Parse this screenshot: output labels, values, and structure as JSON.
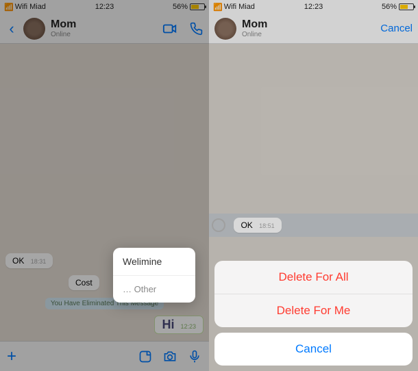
{
  "status": {
    "carrier": "Wifi Miad",
    "time": "12:23",
    "battery_pct": "56%"
  },
  "left": {
    "contact_name": "Mom",
    "contact_status": "Online",
    "messages": {
      "ok_text": "OK",
      "ok_time": "18:31",
      "cost_text": "Cost",
      "system_text": "You Have Eliminated This Message",
      "hi_text": "Hi",
      "hi_time": "12:23"
    },
    "popup": {
      "item1": "Welimine",
      "item2": "… Other"
    },
    "toolbar_plus": "+"
  },
  "right": {
    "contact_name": "Mom",
    "contact_status": "Online",
    "header_cancel": "Cancel",
    "messages": {
      "ok_text": "OK",
      "ok_time": "18:51"
    },
    "sheet": {
      "delete_all": "Delete For All",
      "delete_me": "Delete For Me",
      "cancel": "Cancel"
    }
  }
}
